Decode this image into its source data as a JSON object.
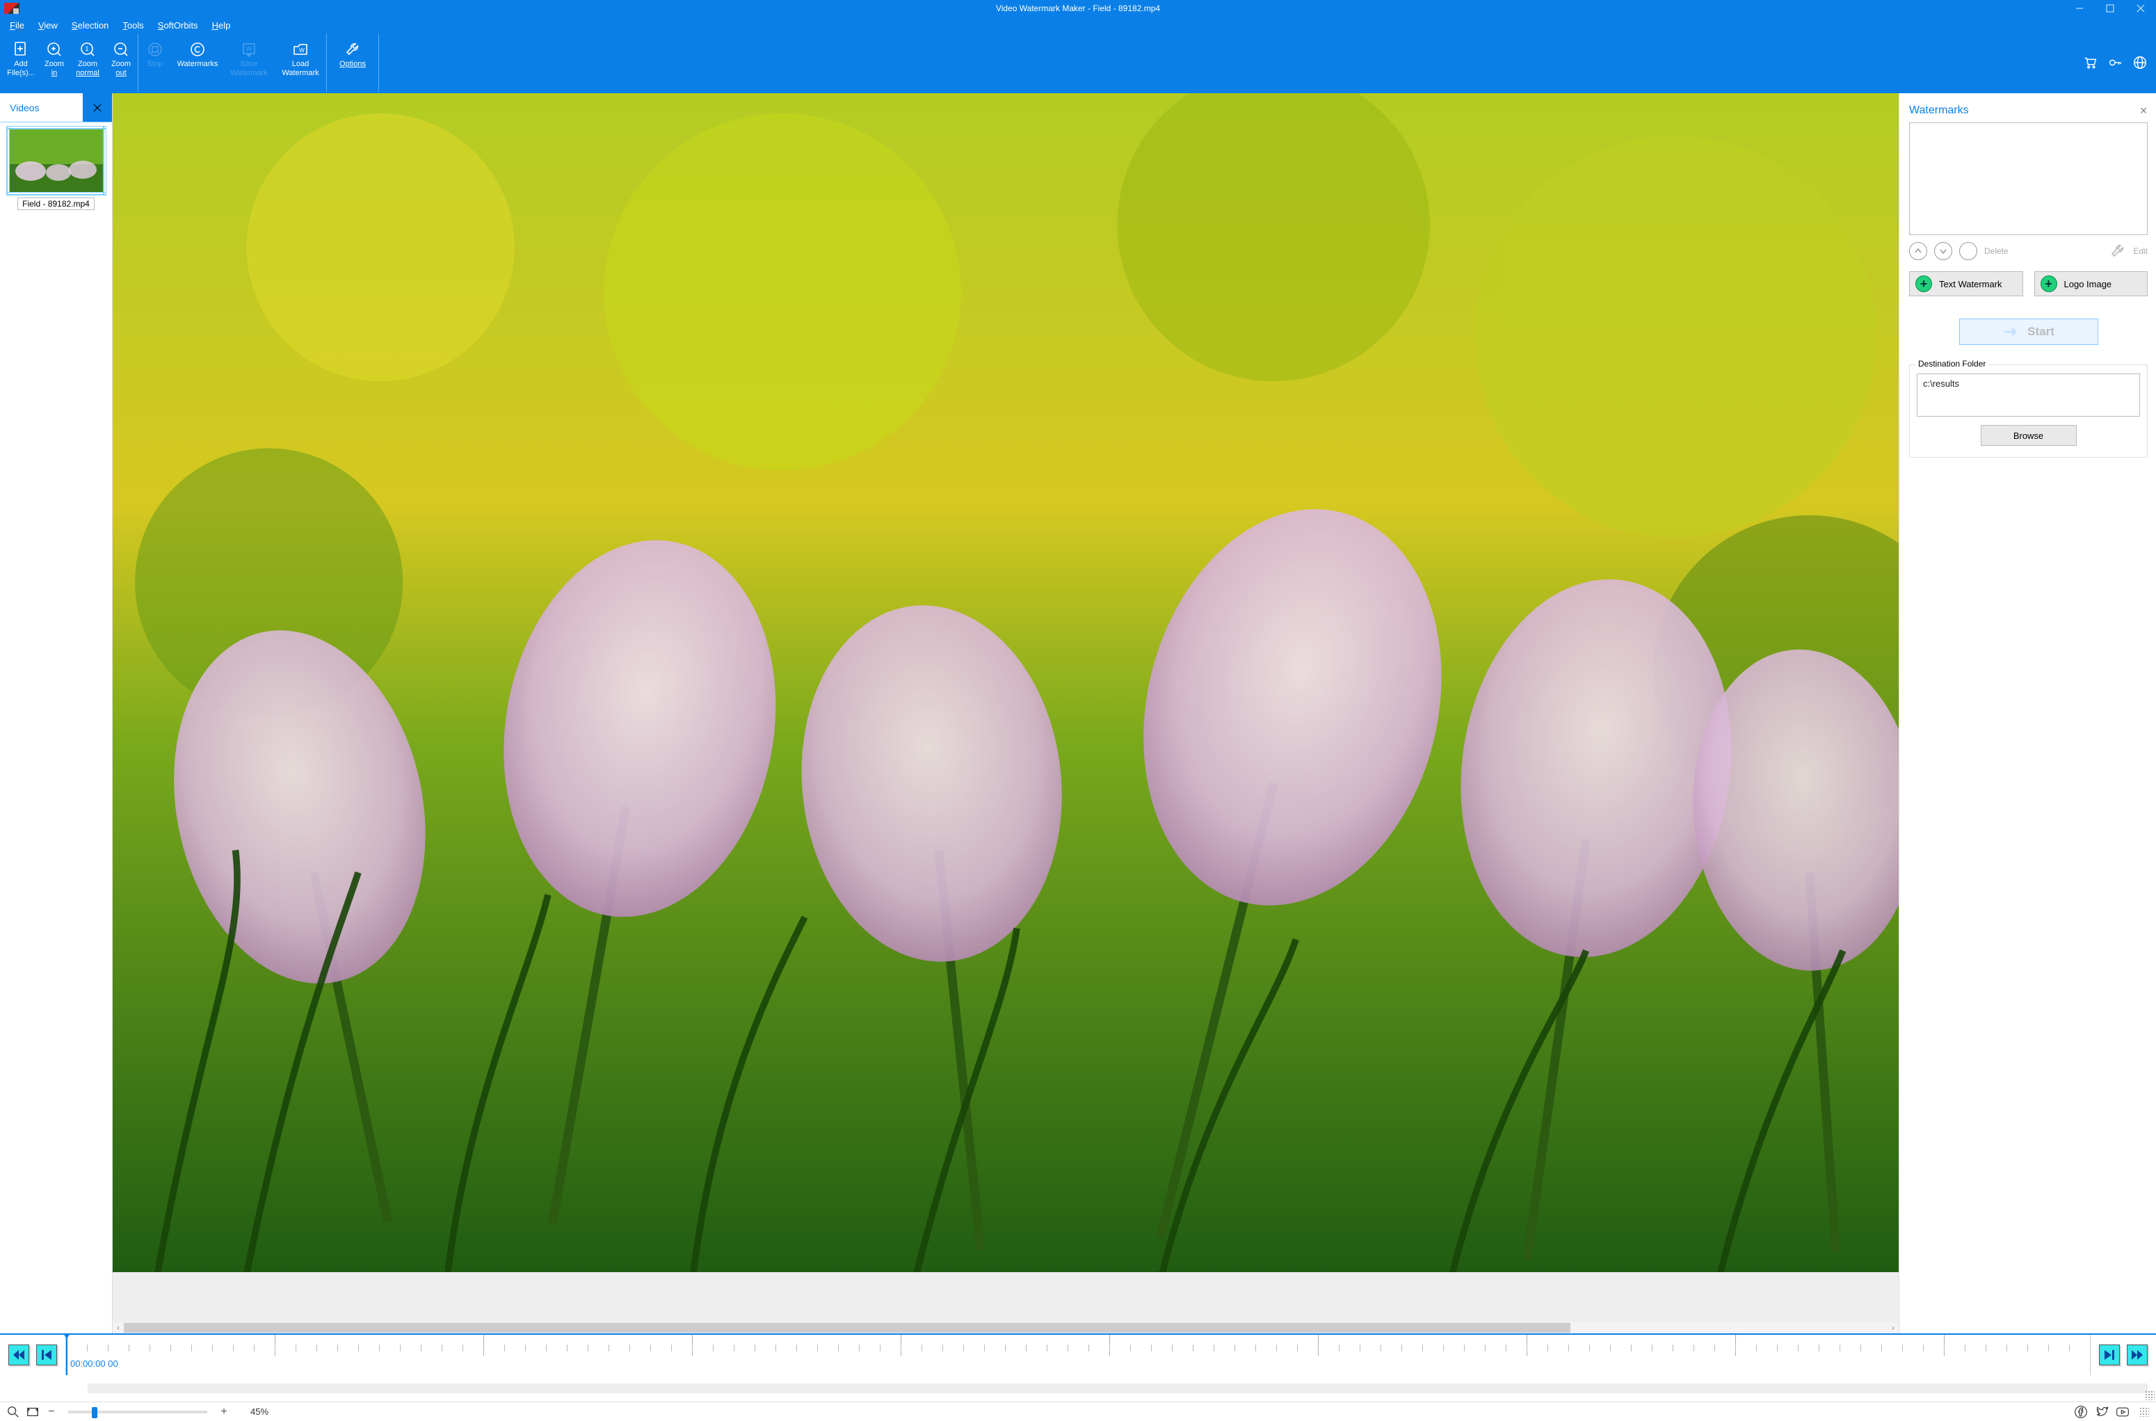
{
  "titlebar": {
    "title": "Video Watermark Maker - Field - 89182.mp4"
  },
  "menu": {
    "file": {
      "hotkey": "F",
      "rest": "ile"
    },
    "view": {
      "hotkey": "V",
      "rest": "iew"
    },
    "selection": {
      "hotkey": "S",
      "rest": "election"
    },
    "tools": {
      "hotkey": "T",
      "rest": "ools"
    },
    "softorbits": {
      "hotkey": "S",
      "rest": "oftOrbits"
    },
    "help": {
      "hotkey": "H",
      "rest": "elp"
    }
  },
  "toolbar": {
    "add_files": {
      "line1": "Add",
      "line2": "File(s)..."
    },
    "zoom_in": {
      "line1": "Zoom",
      "line2": "in",
      "uline2": true
    },
    "zoom_normal": {
      "line1": "Zoom",
      "line2": "normal",
      "uline2": true
    },
    "zoom_out": {
      "line1": "Zoom",
      "line2": "out",
      "uline2": true
    },
    "stop": {
      "line1": "Stop"
    },
    "watermarks": {
      "line1": "Watermarks"
    },
    "save_wm": {
      "line1": "Save",
      "line2": "Watermark"
    },
    "load_wm": {
      "line1": "Load",
      "line2": "Watermark"
    },
    "options": {
      "line1": "Options",
      "uline1": true
    }
  },
  "sidebar": {
    "tab_label": "Videos",
    "items": [
      {
        "caption": "Field - 89182.mp4"
      }
    ]
  },
  "right_panel": {
    "title": "Watermarks",
    "delete_label": "Delete",
    "edit_label": "Edit",
    "text_wm_label": "Text Watermark",
    "logo_label": "Logo Image",
    "start_label": "Start",
    "dest_legend": "Destination Folder",
    "dest_value": "c:\\results",
    "browse_label": "Browse"
  },
  "timeline": {
    "time_label": "00:00:00 00"
  },
  "status": {
    "zoom_percent": "45%",
    "slider_pos_pct": 17
  }
}
